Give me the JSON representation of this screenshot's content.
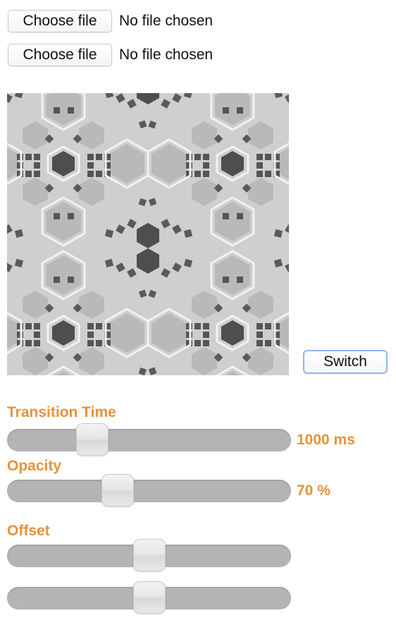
{
  "file_inputs": [
    {
      "button_label": "Choose file",
      "status": "No file chosen"
    },
    {
      "button_label": "Choose file",
      "status": "No file chosen"
    }
  ],
  "switch_button": {
    "label": "Switch"
  },
  "controls": {
    "transition": {
      "label": "Transition Time",
      "value_text": "1000 ms",
      "level": 0.3
    },
    "opacity": {
      "label": "Opacity",
      "value_text": "70 %",
      "level": 0.39
    },
    "offset": {
      "label": "Offset",
      "levels": [
        0.5,
        0.5
      ]
    }
  },
  "colors": {
    "accent": "#e8923c",
    "track": "#b4b4b4",
    "pattern_dark": "#505050",
    "pattern_light": "#bdbdbd"
  }
}
